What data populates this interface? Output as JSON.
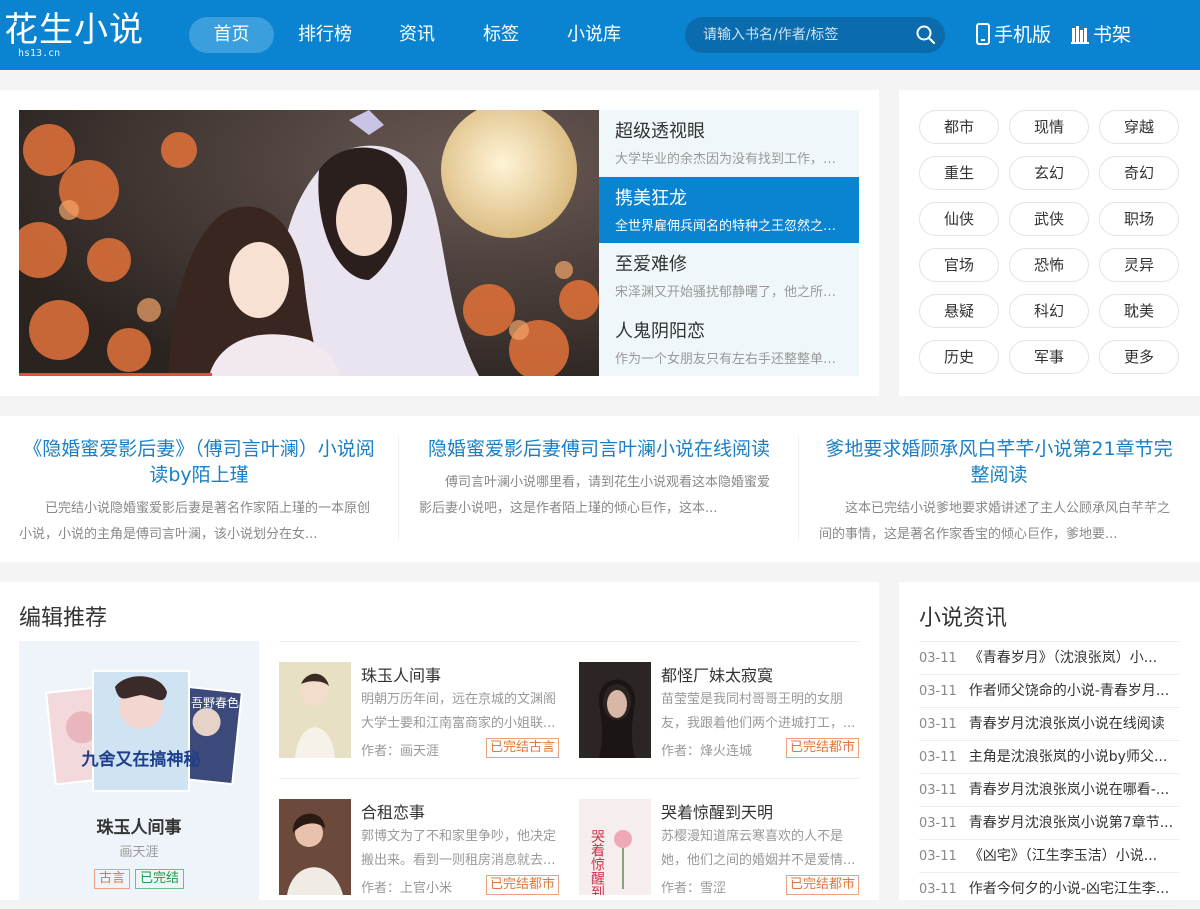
{
  "brand": {
    "logo_text": "花生小说",
    "domain": "hs13.cn",
    "accent": "#0a84d1"
  },
  "nav": [
    {
      "label": "首页",
      "active": true
    },
    {
      "label": "排行榜"
    },
    {
      "label": "资讯"
    },
    {
      "label": "标签"
    },
    {
      "label": "小说库"
    }
  ],
  "search": {
    "placeholder": "请输入书名/作者/标签",
    "icon": "search-icon"
  },
  "tools": {
    "mobile": "手机版",
    "shelf": "书架"
  },
  "slider": [
    {
      "title": "超级透视眼",
      "desc": "大学毕业的余杰因为没有找到工作，求..."
    },
    {
      "title": "携美狂龙",
      "desc": "全世界雇佣兵闻名的特种之王忽然之间...",
      "active": true
    },
    {
      "title": "至爱难修",
      "desc": "宋泽渊又开始骚扰郁静曙了，他之所以..."
    },
    {
      "title": "人鬼阴阳恋",
      "desc": "作为一个女朋友只有左右手还整整单身..."
    }
  ],
  "tags": [
    "都市",
    "现情",
    "穿越",
    "重生",
    "玄幻",
    "奇幻",
    "仙侠",
    "武侠",
    "职场",
    "官场",
    "恐怖",
    "灵异",
    "悬疑",
    "科幻",
    "耽美",
    "历史",
    "军事",
    "更多"
  ],
  "features": [
    {
      "title": "《隐婚蜜爱影后妻》（傅司言叶澜）小说阅读by陌上瑾",
      "desc": "已完结小说隐婚蜜爱影后妻是著名作家陌上瑾的一本原创小说，小说的主角是傅司言叶澜，该小说划分在女..."
    },
    {
      "title": "隐婚蜜爱影后妻傅司言叶澜小说在线阅读",
      "desc": "傅司言叶澜小说哪里看，请到花生小说观看这本隐婚蜜爱影后妻小说吧，这是作者陌上瑾的倾心巨作，这本..."
    },
    {
      "title": "爹地要求婚顾承风白芊芊小说第21章节完整阅读",
      "desc": "这本已完结小说爹地要求婚讲述了主人公顾承风白芊芊之间的事情，这是著名作家香宝的倾心巨作，爹地要..."
    }
  ],
  "editor": {
    "title": "编辑推荐",
    "card": {
      "name": "珠玉人间事",
      "author": "画天涯",
      "badge1": "古言",
      "badge2": "已完结",
      "cover_title": "九舍又在搞神秘",
      "cover_title2": "吾野春色"
    },
    "books": [
      {
        "title": "珠玉人间事",
        "desc": "明朝万历年间，远在京城的文渊阁大学士要和江南富商家的小姐联...",
        "author": "作者：画天涯",
        "badge": "已完结古言"
      },
      {
        "title": "都怪厂妹太寂寞",
        "desc": "苗莹莹是我同村哥哥王明的女朋友，我跟着他们两个进城打工，...",
        "author": "作者：烽火连城",
        "badge": "已完结都市"
      },
      {
        "title": "合租恋事",
        "desc": "郭博文为了不和家里争吵，他决定搬出来。看到一则租房消息就去...",
        "author": "作者：上官小米",
        "badge": "已完结都市"
      },
      {
        "title": "哭着惊醒到天明",
        "desc": "苏樱漫知道席云寒喜欢的人不是她，他们之间的婚姻并不是爱情...",
        "author": "作者：雪涩",
        "badge": "已完结都市",
        "cover_text": "哭着惊醒到天明"
      }
    ]
  },
  "news": {
    "title": "小说资讯",
    "items": [
      {
        "date": "03-11",
        "text": "《青春岁月》（沈浪张岚）小..."
      },
      {
        "date": "03-11",
        "text": "作者师父饶命的小说-青春岁月..."
      },
      {
        "date": "03-11",
        "text": "青春岁月沈浪张岚小说在线阅读"
      },
      {
        "date": "03-11",
        "text": "主角是沈浪张岚的小说by师父..."
      },
      {
        "date": "03-11",
        "text": "青春岁月沈浪张岚小说在哪看-..."
      },
      {
        "date": "03-11",
        "text": "青春岁月沈浪张岚小说第7章节..."
      },
      {
        "date": "03-11",
        "text": "《凶宅》（江生李玉洁）小说..."
      },
      {
        "date": "03-11",
        "text": "作者今何夕的小说-凶宅江生李..."
      }
    ]
  }
}
